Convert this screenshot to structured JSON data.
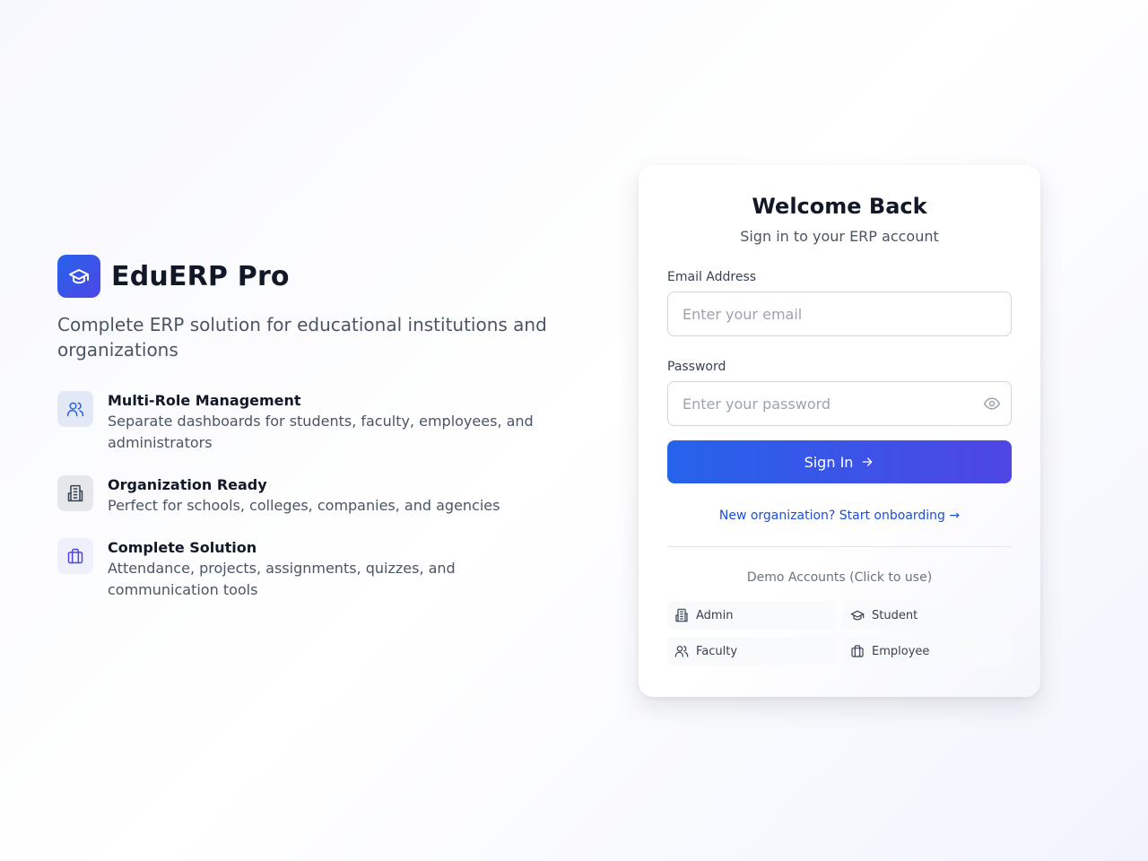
{
  "brand": {
    "name": "EduERP Pro",
    "logo_icon": "graduation-cap-icon"
  },
  "tagline": "Complete ERP solution for educational institutions and organizations",
  "features": [
    {
      "icon": "users-icon",
      "title": "Multi-Role Management",
      "description": "Separate dashboards for students, faculty, employees, and administrators"
    },
    {
      "icon": "building-icon",
      "title": "Organization Ready",
      "description": "Perfect for schools, colleges, companies, and agencies"
    },
    {
      "icon": "briefcase-icon",
      "title": "Complete Solution",
      "description": "Attendance, projects, assignments, quizzes, and communication tools"
    }
  ],
  "login": {
    "title": "Welcome Back",
    "subtitle": "Sign in to your ERP account",
    "email_label": "Email Address",
    "email_placeholder": "Enter your email",
    "email_value": "",
    "password_label": "Password",
    "password_placeholder": "Enter your password",
    "password_value": "",
    "signin_label": "Sign In",
    "onboarding_link": "New organization? Start onboarding →",
    "demo_title": "Demo Accounts (Click to use)",
    "demo_accounts": [
      {
        "label": "Admin",
        "icon": "building-icon"
      },
      {
        "label": "Student",
        "icon": "graduation-cap-icon"
      },
      {
        "label": "Faculty",
        "icon": "users-icon"
      },
      {
        "label": "Employee",
        "icon": "briefcase-icon"
      }
    ]
  },
  "colors": {
    "primary": "#2563eb",
    "primary_end": "#4f46e5",
    "link": "#1d4ed8",
    "text_dark": "#111827",
    "text_muted": "#4b5563"
  }
}
